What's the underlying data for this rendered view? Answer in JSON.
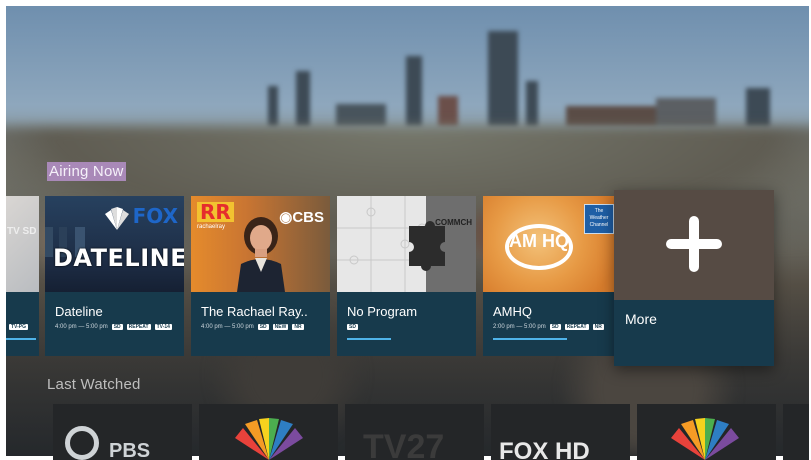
{
  "sections": {
    "airing_now_title": "Airing Now",
    "last_watched_title": "Last Watched"
  },
  "airing_now": [
    {
      "title": "",
      "time": "",
      "badges": [
        "TV-PG"
      ],
      "progress": 0.9
    },
    {
      "title": "Dateline",
      "time": "4:00 pm — 5:00 pm",
      "badges": [
        "SD",
        "REPEAT",
        "TV-14"
      ],
      "progress": 0
    },
    {
      "title": "The Rachael Ray..",
      "time": "4:00 pm — 5:00 pm",
      "badges": [
        "SD",
        "NEW",
        "NR"
      ],
      "progress": 0
    },
    {
      "title": "No Program",
      "time": "",
      "badges": [
        "SD"
      ],
      "progress": 0.35
    },
    {
      "title": "AMHQ",
      "time": "2:00 pm — 5:00 pm",
      "badges": [
        "SD",
        "REPEAT",
        "NR"
      ],
      "progress": 0.6
    }
  ],
  "thumb_text": {
    "partial": "TV SD",
    "dateline_word": "DATELINE",
    "fox": "FOX",
    "rr": "RR",
    "rachael_small": "rachaelray",
    "cbs": "◉CBS",
    "commch": "COMMCH",
    "amhq": "AM HQ",
    "weather_channel": "The Weather Channel"
  },
  "more_card": {
    "label": "More",
    "icon": "plus-icon"
  },
  "last_watched": [
    "PBS",
    "",
    "TV27",
    "FOX HD",
    ""
  ],
  "colors": {
    "card_bg": "#173a4c",
    "progress": "#4fb3e8",
    "highlight": "#a989b8"
  }
}
